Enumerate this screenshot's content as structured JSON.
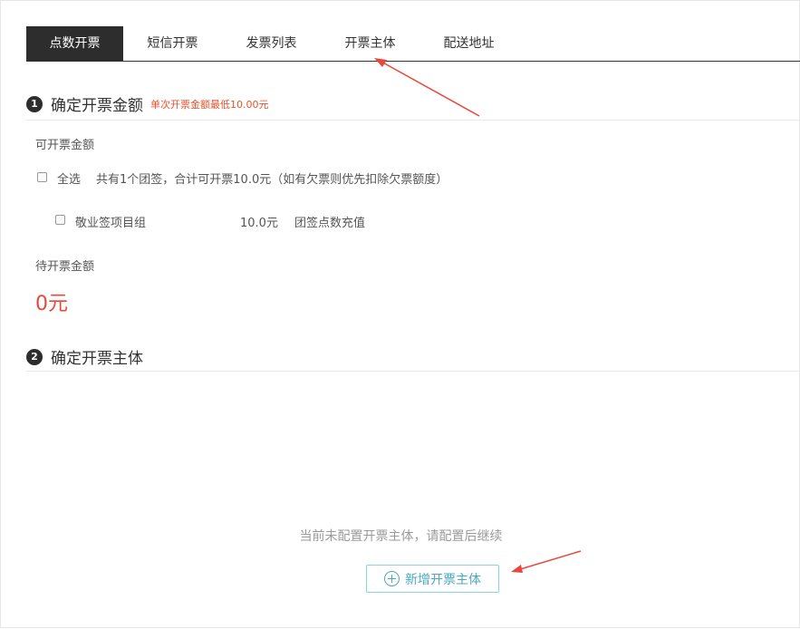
{
  "tabs": [
    {
      "label": "点数开票",
      "active": true
    },
    {
      "label": "短信开票",
      "active": false
    },
    {
      "label": "发票列表",
      "active": false
    },
    {
      "label": "开票主体",
      "active": false
    },
    {
      "label": "配送地址",
      "active": false
    }
  ],
  "section1": {
    "number": "1",
    "title": "确定开票金额",
    "note": "单次开票金额最低10.00元",
    "available_label": "可开票金额",
    "select_all_label": "全选",
    "summary": "共有1个团签，合计可开票10.0元（如有欠票则优先扣除欠票额度）",
    "item": {
      "name": "敬业签项目组",
      "amount": "10.0元",
      "type": "团签点数充值"
    },
    "pending_label": "待开票金额",
    "pending_amount": "0元"
  },
  "section2": {
    "number": "2",
    "title": "确定开票主体",
    "empty_message": "当前未配置开票主体，请配置后继续",
    "add_button": "新增开票主体"
  },
  "colors": {
    "active_tab": "#2d2d2d",
    "note": "#e94f2c",
    "amount": "#e8473b",
    "accent": "#4aa8c0",
    "annotation_arrow": "#e8473b"
  },
  "icons": {
    "add": "plus-circle-icon"
  }
}
